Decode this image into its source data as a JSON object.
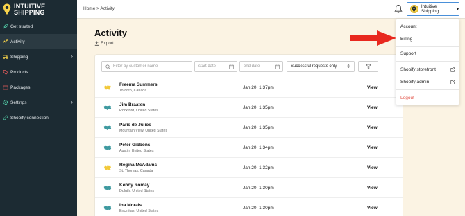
{
  "logo": {
    "line1": "INTUITIVE",
    "line2": "SHIPPING"
  },
  "sidebar": {
    "items": [
      {
        "label": "Get started",
        "icon": "rocket-icon"
      },
      {
        "label": "Activity",
        "icon": "activity-icon",
        "active": true
      },
      {
        "label": "Shipping",
        "icon": "truck-icon",
        "has_children": true
      },
      {
        "label": "Products",
        "icon": "tag-icon"
      },
      {
        "label": "Packages",
        "icon": "box-icon"
      },
      {
        "label": "Settings",
        "icon": "gear-icon",
        "has_children": true
      },
      {
        "label": "Shopify connection",
        "icon": "link-icon"
      }
    ]
  },
  "header": {
    "breadcrumb": "Home > Activity",
    "user_name": "Intuitive Shipping"
  },
  "page": {
    "title": "Activity",
    "export_label": "Export"
  },
  "filters": {
    "search_placeholder": "Filter by customer name",
    "start_placeholder": "start date",
    "end_placeholder": "end date",
    "status_selected": "Successful requests only"
  },
  "rows": [
    {
      "name": "Freema Summers",
      "location": "Toronto, Canada",
      "date": "Jan 20, 1:37pm",
      "view": "View",
      "flag": "CA"
    },
    {
      "name": "Jim Braaten",
      "location": "Rockford, United States",
      "date": "Jan 20, 1:35pm",
      "view": "View",
      "flag": "US"
    },
    {
      "name": "Paris de Julios",
      "location": "Mountain View, United States",
      "date": "Jan 20, 1:35pm",
      "view": "View",
      "flag": "US"
    },
    {
      "name": "Peter Gibbons",
      "location": "Austin, United States",
      "date": "Jan 20, 1:34pm",
      "view": "View",
      "flag": "US"
    },
    {
      "name": "Regina McAdams",
      "location": "St. Thomas, Canada",
      "date": "Jan 20, 1:32pm",
      "view": "View",
      "flag": "CA"
    },
    {
      "name": "Kenny Romay",
      "location": "Duluth, United States",
      "date": "Jan 20, 1:30pm",
      "view": "View",
      "flag": "US"
    },
    {
      "name": "Ina Morais",
      "location": "Encinitas, United States",
      "date": "Jan 20, 1:30pm",
      "view": "View",
      "flag": "US"
    }
  ],
  "dropdown": {
    "account": "Account",
    "billing": "Billing",
    "support": "Support",
    "shopify_storefront": "Shopify storefront",
    "shopify_admin": "Shopify admin",
    "logout": "Logout"
  },
  "colors": {
    "sidebar_bg": "#1c2b33",
    "page_bg": "#fbf3e3",
    "accent_yellow": "#f6d24a",
    "arrow_red": "#e8281e",
    "logout_red": "#e2564b",
    "us_map_teal": "#3f9aa0",
    "ca_map_yellow": "#f2c93a"
  }
}
